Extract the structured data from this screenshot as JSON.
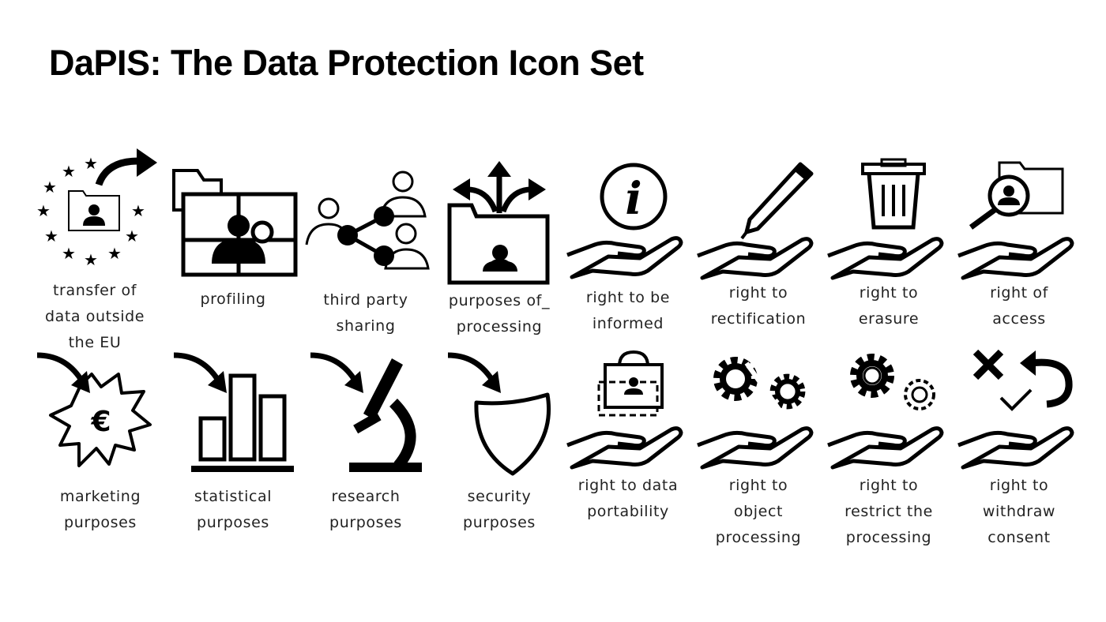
{
  "title": "DaPIS: The Data Protection Icon Set",
  "icons": [
    {
      "id": "transfer",
      "lines": [
        "transfer of",
        "data outside",
        "the EU"
      ]
    },
    {
      "id": "profiling",
      "lines": [
        "profiling"
      ]
    },
    {
      "id": "third-party",
      "lines": [
        "third party",
        "sharing"
      ]
    },
    {
      "id": "purposes",
      "lines": [
        "purposes of_",
        "processing"
      ]
    },
    {
      "id": "informed",
      "lines": [
        "right to be",
        "informed"
      ]
    },
    {
      "id": "rectification",
      "lines": [
        "right to",
        "rectification"
      ]
    },
    {
      "id": "erasure",
      "lines": [
        "right to",
        "erasure"
      ]
    },
    {
      "id": "access",
      "lines": [
        "right of",
        "access"
      ]
    },
    {
      "id": "marketing",
      "lines": [
        "marketing",
        "purposes"
      ]
    },
    {
      "id": "statistical",
      "lines": [
        "statistical",
        "purposes"
      ]
    },
    {
      "id": "research",
      "lines": [
        "research",
        "purposes"
      ]
    },
    {
      "id": "security",
      "lines": [
        "security",
        "purposes"
      ]
    },
    {
      "id": "portability",
      "lines": [
        "right to data",
        "portability"
      ]
    },
    {
      "id": "object",
      "lines": [
        "right to",
        "object",
        "processing"
      ]
    },
    {
      "id": "restrict",
      "lines": [
        "right to",
        "restrict the",
        "processing"
      ]
    },
    {
      "id": "withdraw",
      "lines": [
        "right to",
        "withdraw",
        "consent"
      ]
    }
  ],
  "symbols": {
    "euro": "€",
    "info": "i"
  }
}
